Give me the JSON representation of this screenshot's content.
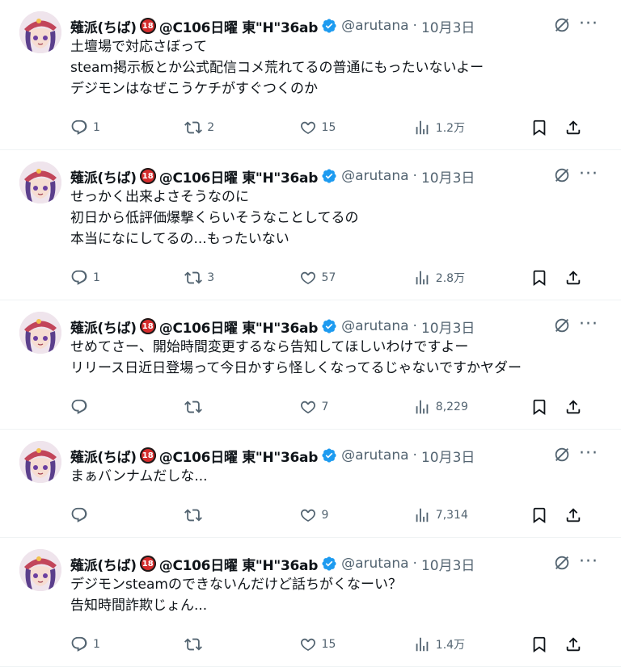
{
  "author": {
    "name": "薙派(ちば)",
    "r18_label": "18",
    "name_rest": "@C106日曜 東\"H\"36ab",
    "handle": "@arutana",
    "separator": "·"
  },
  "icons": {
    "verified": "verified-badge-icon",
    "grok": "grok-icon",
    "more": "more-icon",
    "reply": "reply-icon",
    "retweet": "retweet-icon",
    "like": "like-icon",
    "views": "views-icon",
    "bookmark": "bookmark-icon",
    "share": "share-icon"
  },
  "colors": {
    "verified": "#1d9bf0",
    "muted": "#536471",
    "r18": "#d42b2b"
  },
  "tweets": [
    {
      "date": "10月3日",
      "text": "土壇場で対応さぼって\nsteam掲示板とか公式配信コメ荒れてるの普通にもったいないよー\nデジモンはなぜこうケチがすぐつくのか",
      "replies": "1",
      "retweets": "2",
      "likes": "15",
      "views": "1.2万"
    },
    {
      "date": "10月3日",
      "text": "せっかく出来よさそうなのに\n初日から低評価爆撃くらいそうなことしてるの\n本当になにしてるの...もったいない",
      "replies": "1",
      "retweets": "3",
      "likes": "57",
      "views": "2.8万"
    },
    {
      "date": "10月3日",
      "text": "せめてさー、開始時間変更するなら告知してほしいわけですよー\nリリース日近日登場って今日かすら怪しくなってるじゃないですかヤダー",
      "replies": "",
      "retweets": "",
      "likes": "7",
      "views": "8,229"
    },
    {
      "date": "10月3日",
      "text": "まぁバンナムだしな...",
      "replies": "",
      "retweets": "",
      "likes": "9",
      "views": "7,314"
    },
    {
      "date": "10月3日",
      "text": "デジモンsteamのできないんだけど話ちがくなーい？\n告知時間詐欺じょん...",
      "replies": "1",
      "retweets": "",
      "likes": "15",
      "views": "1.4万"
    }
  ]
}
